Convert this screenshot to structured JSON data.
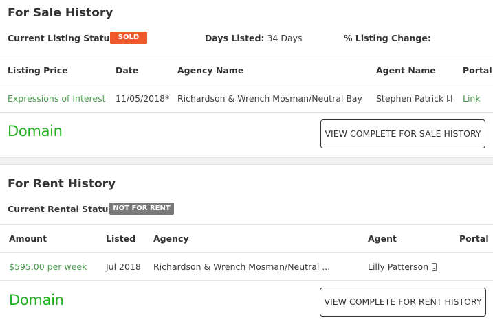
{
  "sale": {
    "title": "For Sale History",
    "status_label": "Current Listing Status:",
    "status_badge": "SOLD",
    "days_label": "Days Listed:",
    "days_value": "34 Days",
    "change_label": "% Listing Change:",
    "columns": [
      "Listing Price",
      "Date",
      "Agency Name",
      "Agent Name",
      "Portal"
    ],
    "row": {
      "price": "Expressions of Interest",
      "date": "11/05/2018*",
      "agency": "Richardson & Wrench Mosman/Neutral Bay",
      "agent": "Stephen Patrick",
      "portal": "Link"
    },
    "logo": "Domain",
    "button": "VIEW COMPLETE FOR SALE HISTORY"
  },
  "rent": {
    "title": "For Rent History",
    "status_label": "Current Rental Status:",
    "status_badge": "NOT FOR RENT",
    "columns": [
      "Amount",
      "Listed",
      "Agency",
      "Agent",
      "Portal"
    ],
    "row": {
      "amount": "$595.00 per week",
      "listed": "Jul 2018",
      "agency": "Richardson & Wrench Mosman/Neutral ...",
      "agent": "Lilly Patterson"
    },
    "logo": "Domain",
    "button": "VIEW COMPLETE FOR RENT HISTORY"
  },
  "colors": {
    "sold_badge": "#ee5a2b",
    "not_for_rent_badge": "#7a7a7a",
    "green_text": "#4a9b4e",
    "domain_logo": "#1eb01e"
  }
}
